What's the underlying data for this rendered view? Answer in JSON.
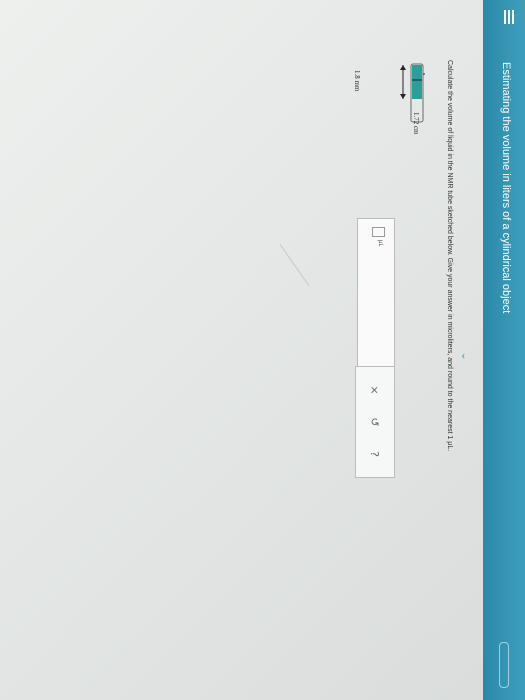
{
  "header": {
    "title": "Estimating the volume in liters of a cylindrical object"
  },
  "question": {
    "text": "Calculate the volume of liquid in the NMR tube sketched below. Give your answer in microliters, and round to the nearest 1 μL."
  },
  "diagram": {
    "height_label": "1.72 cm",
    "diameter_label": "1.8 mm",
    "liquid_color": "#2aa198"
  },
  "answer": {
    "unit": "μL"
  },
  "toolbar": {
    "clear_icon": "×",
    "undo_icon": "↺",
    "help_icon": "?"
  },
  "colors": {
    "accent": "#2b89a8"
  }
}
